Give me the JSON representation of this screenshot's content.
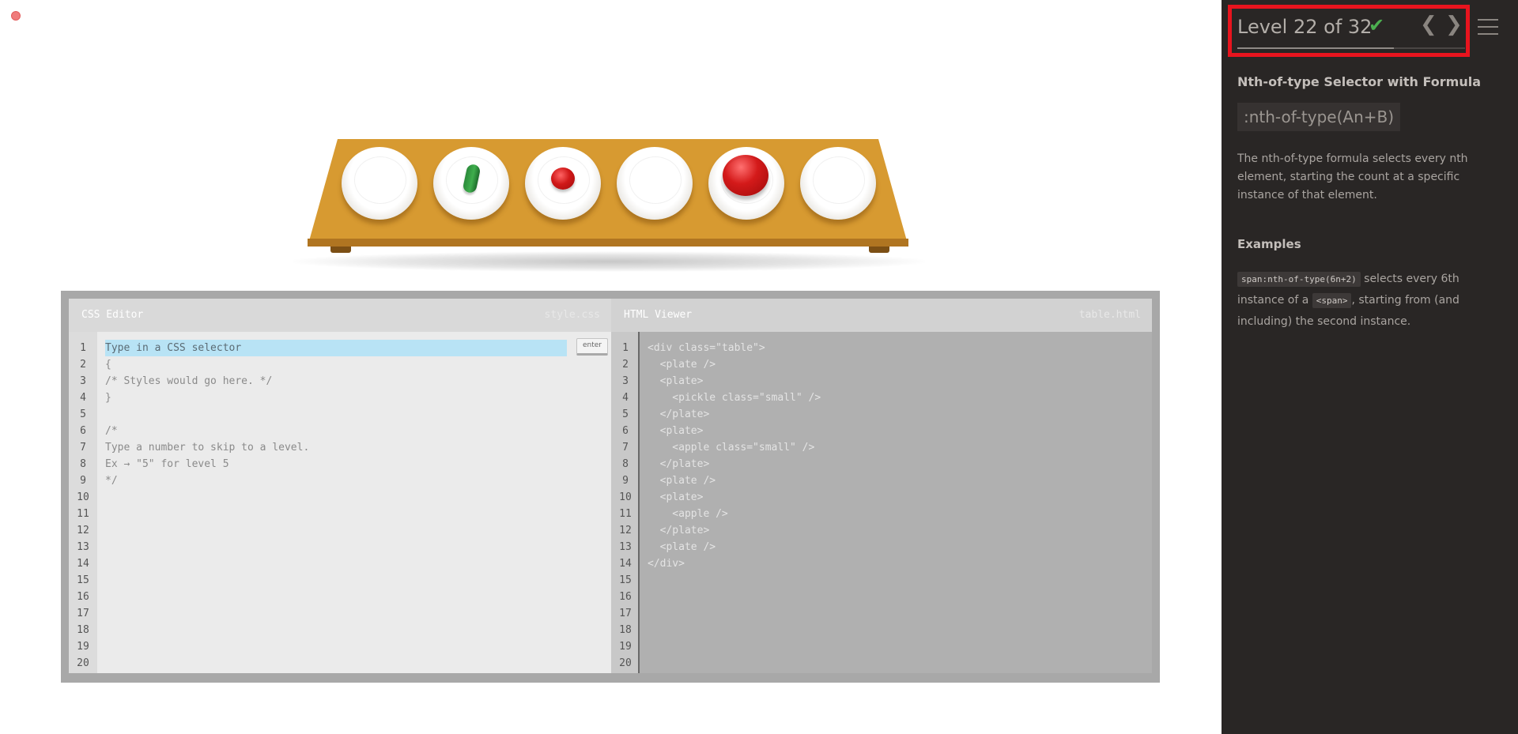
{
  "level": {
    "title": "Level 22 of 32",
    "completed": true,
    "progress": 0.6875
  },
  "sidebar": {
    "name": "Nth-of-type Selector with Formula",
    "selector": ":nth-of-type(An+B)",
    "description": "The nth-of-type formula selects every nth element, starting the count at a specific instance of that element.",
    "examples_heading": "Examples",
    "example": {
      "code": "span:nth-of-type(6n+2)",
      "text_a": " selects every 6th instance of a ",
      "tag": "<span>",
      "text_b": ", starting from (and including) the second instance."
    }
  },
  "table": {
    "items": [
      "plate",
      "plate with small pickle",
      "plate with small apple",
      "plate",
      "plate with apple",
      "plate"
    ]
  },
  "css_editor": {
    "title": "CSS Editor",
    "filename": "style.css",
    "placeholder": "Type in a CSS selector",
    "enter_label": "enter",
    "lines": [
      "{",
      "/* Styles would go here. */",
      "}",
      "",
      "/*",
      "Type a number to skip to a level.",
      "Ex → \"5\" for level 5",
      "*/"
    ],
    "line_count": 20
  },
  "html_viewer": {
    "title": "HTML Viewer",
    "filename": "table.html",
    "lines": [
      "<div class=\"table\">",
      "  <plate />",
      "  <plate>",
      "    <pickle class=\"small\" />",
      "  </plate>",
      "  <plate>",
      "    <apple class=\"small\" />",
      "  </plate>",
      "  <plate />",
      "  <plate>",
      "    <apple />",
      "  </plate>",
      "  <plate />",
      "</div>"
    ],
    "line_count": 20
  },
  "colors": {
    "sidebar_bg": "#292625",
    "table": "#d79a31",
    "highlight_box": "#e8141e",
    "check": "#4caf50",
    "input_highlight": "#b8e3f5"
  }
}
